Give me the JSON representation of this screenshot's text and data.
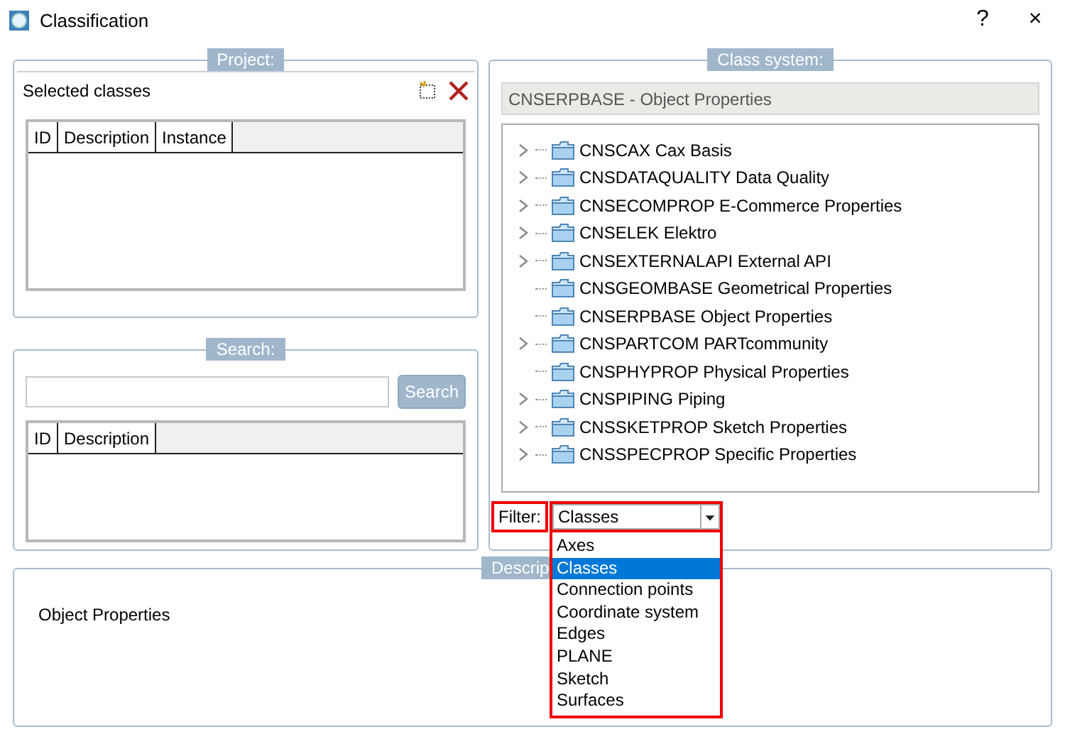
{
  "window": {
    "title": "Classification",
    "help": "?",
    "close": "×"
  },
  "project": {
    "title": "Project:",
    "header": "Selected classes",
    "columns": [
      "ID",
      "Description",
      "Instance"
    ]
  },
  "search": {
    "title": "Search:",
    "button": "Search",
    "columns": [
      "ID",
      "Description"
    ]
  },
  "class_system": {
    "title": "Class system:",
    "current": "CNSERPBASE - Object Properties",
    "tree": [
      {
        "label": "CNSCAX Cax Basis",
        "expandable": true
      },
      {
        "label": "CNSDATAQUALITY Data Quality",
        "expandable": true
      },
      {
        "label": "CNSECOMPROP E-Commerce Properties",
        "expandable": true
      },
      {
        "label": "CNSELEK Elektro",
        "expandable": true
      },
      {
        "label": "CNSEXTERNALAPI External API",
        "expandable": true
      },
      {
        "label": "CNSGEOMBASE Geometrical Properties",
        "expandable": false
      },
      {
        "label": "CNSERPBASE Object Properties",
        "expandable": false
      },
      {
        "label": "CNSPARTCOM PARTcommunity",
        "expandable": true
      },
      {
        "label": "CNSPHYPROP Physical Properties",
        "expandable": false
      },
      {
        "label": "CNSPIPING Piping",
        "expandable": true
      },
      {
        "label": "CNSSKETPROP Sketch Properties",
        "expandable": true
      },
      {
        "label": "CNSSPECPROP Specific Properties",
        "expandable": true
      }
    ],
    "filter_label": "Filter:",
    "filter_value": "Classes",
    "filter_options": [
      {
        "label": "Axes",
        "selected": false
      },
      {
        "label": "Classes",
        "selected": true
      },
      {
        "label": "Connection points",
        "selected": false
      },
      {
        "label": "Coordinate system",
        "selected": false
      },
      {
        "label": "Edges",
        "selected": false
      },
      {
        "label": "PLANE",
        "selected": false
      },
      {
        "label": "Sketch",
        "selected": false
      },
      {
        "label": "Surfaces",
        "selected": false
      }
    ]
  },
  "description": {
    "title": "Descrip",
    "text": "Object Properties"
  }
}
